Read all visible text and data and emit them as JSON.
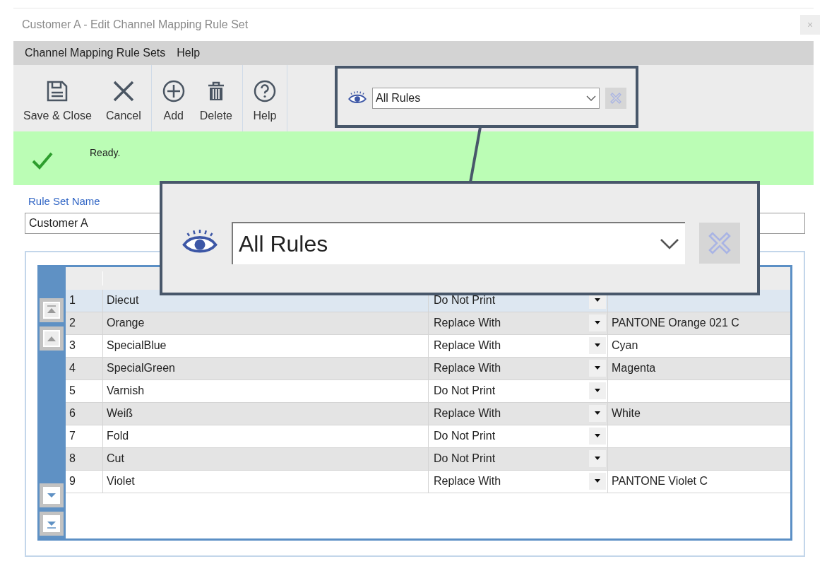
{
  "window": {
    "title": "Customer A - Edit Channel Mapping Rule Set",
    "close": "×"
  },
  "menu": [
    "Channel Mapping Rule Sets",
    "Help"
  ],
  "toolbar": {
    "groups": [
      [
        {
          "kind": "save",
          "label": "Save & Close"
        },
        {
          "kind": "cancel",
          "label": "Cancel"
        }
      ],
      [
        {
          "kind": "add",
          "label": "Add"
        },
        {
          "kind": "delete",
          "label": "Delete"
        }
      ],
      [
        {
          "kind": "help",
          "label": "Help"
        }
      ]
    ],
    "filter": {
      "value": "All Rules",
      "clear_disabled": true
    }
  },
  "status": {
    "kind": "ok",
    "message": "Ready."
  },
  "rule_set_name": {
    "label": "Rule Set Name",
    "value": "Customer A"
  },
  "table": {
    "rows": [
      {
        "number": "1",
        "channel": "Diecut",
        "action": "Do Not Print",
        "replacement": "",
        "selected": true
      },
      {
        "number": "2",
        "channel": "Orange",
        "action": "Replace With",
        "replacement": "PANTONE Orange 021 C",
        "selected": false
      },
      {
        "number": "3",
        "channel": "SpecialBlue",
        "action": "Replace With",
        "replacement": "Cyan",
        "selected": false
      },
      {
        "number": "4",
        "channel": "SpecialGreen",
        "action": "Replace With",
        "replacement": "Magenta",
        "selected": false
      },
      {
        "number": "5",
        "channel": "Varnish",
        "action": "Do Not Print",
        "replacement": "",
        "selected": false
      },
      {
        "number": "6",
        "channel": "Weiß",
        "action": "Replace With",
        "replacement": "White",
        "selected": false
      },
      {
        "number": "7",
        "channel": "Fold",
        "action": "Do Not Print",
        "replacement": "",
        "selected": false
      },
      {
        "number": "8",
        "channel": "Cut",
        "action": "Do Not Print",
        "replacement": "",
        "selected": false
      },
      {
        "number": "9",
        "channel": "Violet",
        "action": "Replace With",
        "replacement": "PANTONE Violet C",
        "selected": false
      }
    ]
  },
  "callout": {
    "value": "All Rules",
    "clear_disabled": true
  }
}
